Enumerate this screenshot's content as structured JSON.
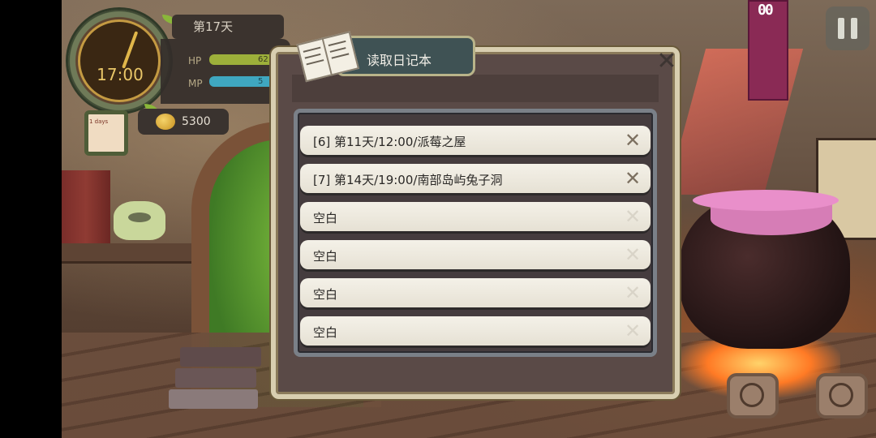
{
  "hud": {
    "day": "第17天",
    "time": "17:00",
    "hp_label": "HP",
    "hp_value": "62",
    "hp_fraction": 0.95,
    "mp_label": "MP",
    "mp_value": "5",
    "mp_fraction": 0.95,
    "gold": "5300",
    "note_text": "1 days"
  },
  "scene": {
    "hanging_sign": "00"
  },
  "dialog": {
    "title": "读取日记本",
    "close_glyph": "✕",
    "slots": [
      {
        "label": "[6] 第11天/12:00/派莓之屋",
        "delete_glyph": "✕",
        "empty": false
      },
      {
        "label": "[7] 第14天/19:00/南部岛屿兔子洞",
        "delete_glyph": "✕",
        "empty": false
      },
      {
        "label": "空白",
        "delete_glyph": "✕",
        "empty": true
      },
      {
        "label": "空白",
        "delete_glyph": "✕",
        "empty": true
      },
      {
        "label": "空白",
        "delete_glyph": "✕",
        "empty": true
      },
      {
        "label": "空白",
        "delete_glyph": "✕",
        "empty": true
      }
    ]
  },
  "colors": {
    "title_tab_bg": "#3f5254",
    "hp_bar": "#9db03a",
    "mp_bar": "#3fa7c0",
    "slot_bg": "#f0ece2"
  },
  "icons": {
    "pause": "pause-icon",
    "gold": "coin-icon",
    "diary": "open-book-icon",
    "close": "close-icon",
    "delete": "delete-x-icon"
  }
}
